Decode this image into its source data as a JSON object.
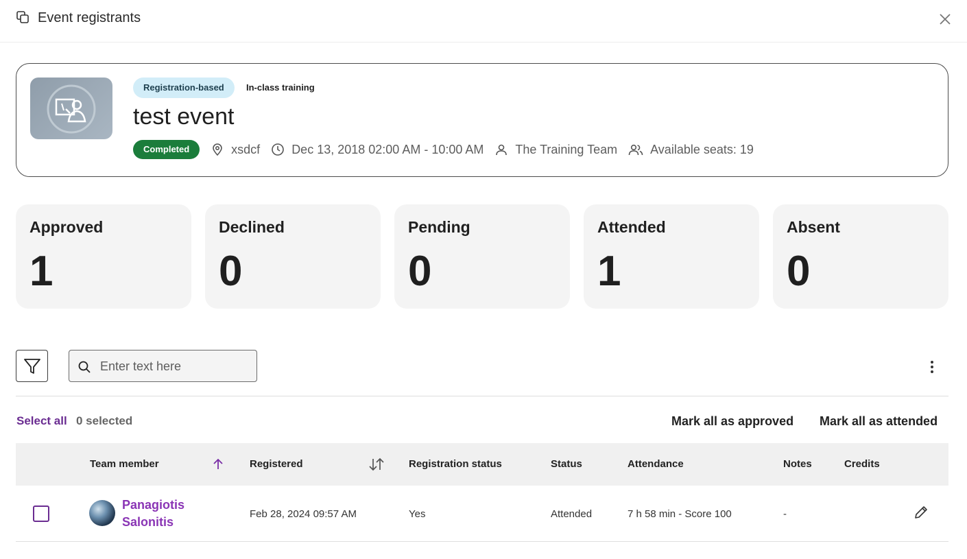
{
  "header": {
    "title": "Event registrants"
  },
  "event": {
    "registration_type": "Registration-based",
    "training_type": "In-class training",
    "title": "test event",
    "status": "Completed",
    "location": "xsdcf",
    "datetime": "Dec 13, 2018 02:00 AM - 10:00 AM",
    "instructor": "The Training Team",
    "seats": "Available seats: 19"
  },
  "stats": [
    {
      "label": "Approved",
      "value": "1"
    },
    {
      "label": "Declined",
      "value": "0"
    },
    {
      "label": "Pending",
      "value": "0"
    },
    {
      "label": "Attended",
      "value": "1"
    },
    {
      "label": "Absent",
      "value": "0"
    }
  ],
  "search": {
    "placeholder": "Enter text here"
  },
  "bulk": {
    "select_all": "Select all",
    "selected_count": "0 selected",
    "mark_approved": "Mark all as approved",
    "mark_attended": "Mark all as attended"
  },
  "table": {
    "columns": [
      "Team member",
      "Registered",
      "Registration status",
      "Status",
      "Attendance",
      "Notes",
      "Credits"
    ],
    "rows": [
      {
        "name": "Panagiotis Salonitis",
        "registered": "Feb 28, 2024 09:57 AM",
        "registration_status": "Yes",
        "status": "Attended",
        "attendance": "7 h 58 min - Score 100",
        "notes": "-",
        "credits": ""
      }
    ]
  },
  "colors": {
    "accent": "#6a2c91",
    "link": "#8a35b5",
    "completed": "#1b7d3b",
    "tag_bg": "#d2edf8"
  }
}
